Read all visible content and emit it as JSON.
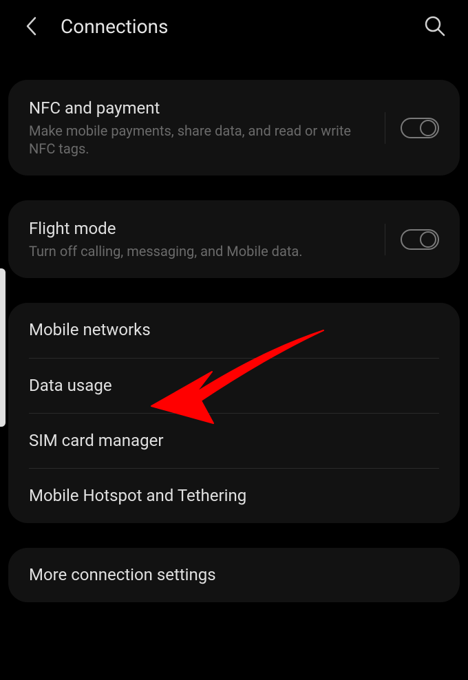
{
  "header": {
    "title": "Connections"
  },
  "cards": {
    "nfc": {
      "title": "NFC and payment",
      "subtitle": "Make mobile payments, share data, and read or write NFC tags."
    },
    "flight": {
      "title": "Flight mode",
      "subtitle": "Turn off calling, messaging, and Mobile data."
    },
    "networks": {
      "mobile_networks": "Mobile networks",
      "data_usage": "Data usage",
      "sim_manager": "SIM card manager",
      "hotspot": "Mobile Hotspot and Tethering"
    },
    "more": {
      "title": "More connection settings"
    }
  }
}
